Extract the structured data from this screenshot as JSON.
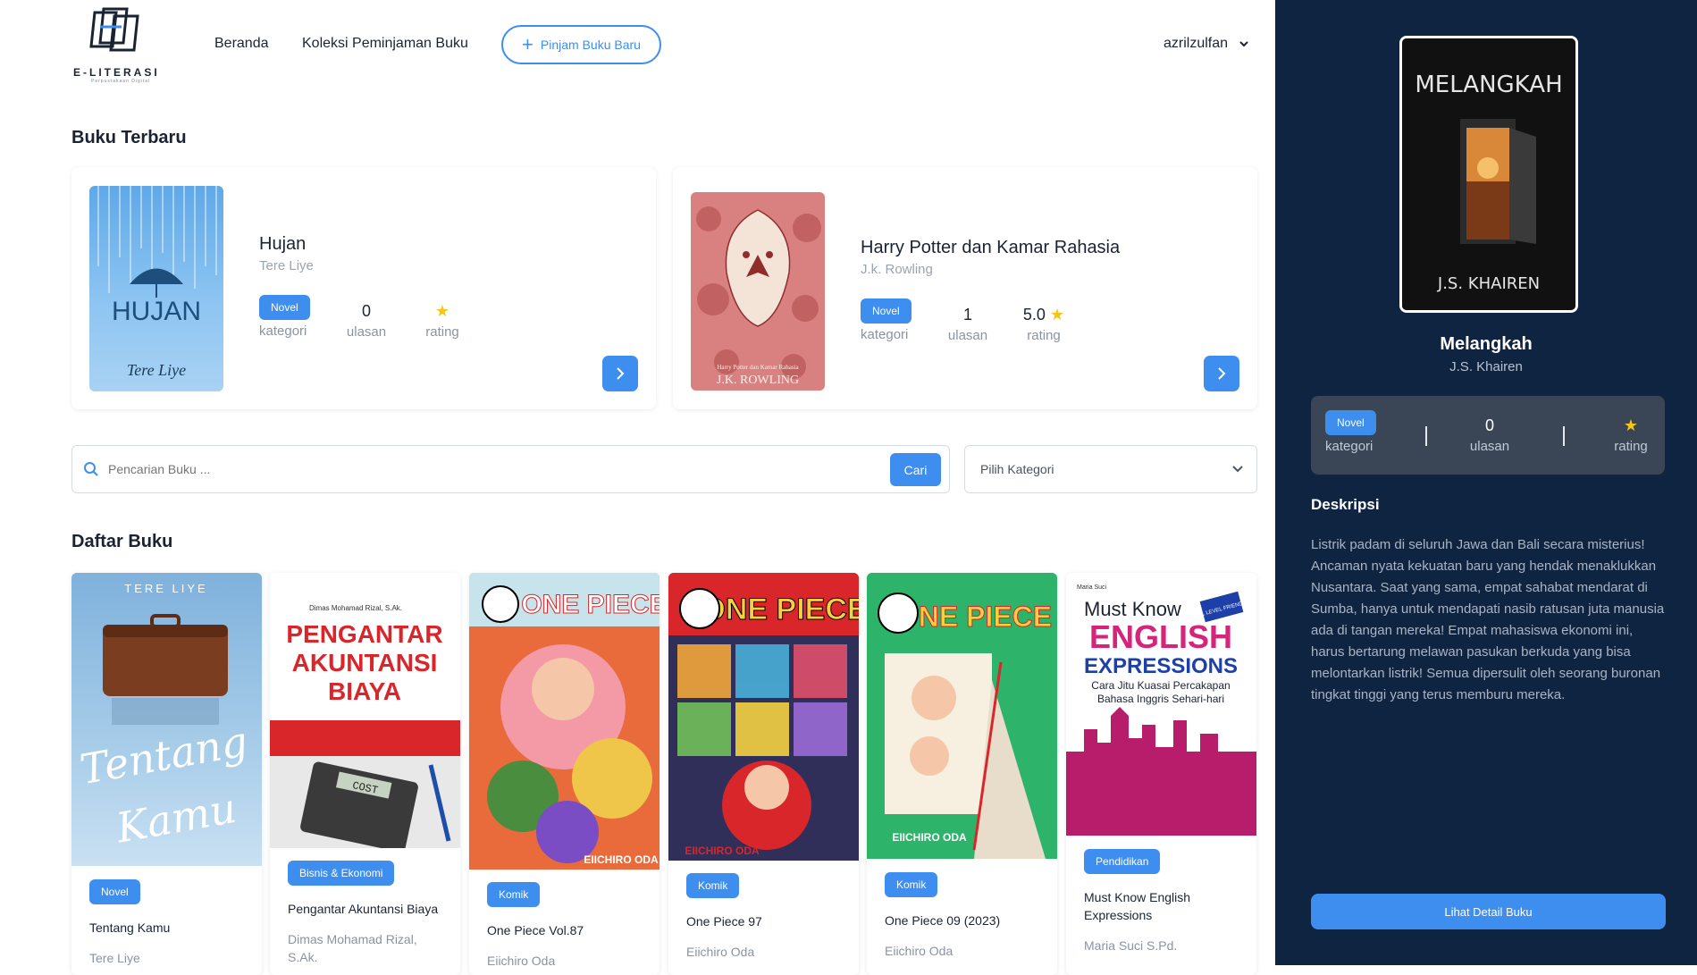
{
  "header": {
    "logo_text": "E-LITERASI",
    "logo_subtext": "Perpustakaan Digital",
    "nav": [
      "Beranda",
      "Koleksi Peminjaman Buku"
    ],
    "cta_label": "Pinjam Buku Baru",
    "username": "azrilzulfan"
  },
  "latest": {
    "title": "Buku Terbaru",
    "books": [
      {
        "title": "Hujan",
        "author": "Tere Liye",
        "category": "Novel",
        "category_label": "kategori",
        "reviews": "0",
        "reviews_label": "ulasan",
        "rating": "",
        "rating_label": "rating"
      },
      {
        "title": "Harry Potter dan Kamar Rahasia",
        "author": "J.k. Rowling",
        "category": "Novel",
        "category_label": "kategori",
        "reviews": "1",
        "reviews_label": "ulasan",
        "rating": "5.0",
        "rating_label": "rating"
      }
    ]
  },
  "search": {
    "placeholder": "Pencarian Buku ...",
    "button": "Cari",
    "category_select": "Pilih Kategori"
  },
  "list": {
    "title": "Daftar Buku",
    "books": [
      {
        "title": "Tentang Kamu",
        "author": "Tere Liye",
        "category": "Novel"
      },
      {
        "title": "Pengantar Akuntansi Biaya",
        "author": "Dimas Mohamad Rizal, S.Ak.",
        "category": "Bisnis & Ekonomi"
      },
      {
        "title": "One Piece Vol.87",
        "author": "Eiichiro Oda",
        "category": "Komik"
      },
      {
        "title": "One Piece 97",
        "author": "Eiichiro Oda",
        "category": "Komik"
      },
      {
        "title": "One Piece 09 (2023)",
        "author": "Eiichiro Oda",
        "category": "Komik"
      },
      {
        "title": "Must Know English Expressions",
        "author": "Maria Suci S.Pd.",
        "category": "Pendidikan"
      }
    ]
  },
  "covers": {
    "hujan": {
      "title": "HUJAN",
      "author": "Tere Liye"
    },
    "hp": {
      "author": "J.K. ROWLING",
      "subtitle": "Harry Potter dan Kamar Rahasia"
    },
    "tentang": {
      "author": "TERE LIYE",
      "title1": "Tentang",
      "title2": "Kamu"
    },
    "akuntansi": {
      "author": "Dimas Mohamad Rizal, S.Ak.",
      "title1": "PENGANTAR",
      "title2": "AKUNTANSI",
      "title3": "BIAYA",
      "sign": "COST"
    },
    "op": {
      "title": "ONE PIECE",
      "author": "EIICHIRO ODA"
    },
    "english": {
      "author": "Maria Suci",
      "line1": "Must Know",
      "line2": "ENGLISH",
      "line3": "EXPRESSIONS",
      "line4": "Cara Jitu Kuasai Percakapan",
      "line5": "Bahasa Inggris Sehari-hari",
      "tag": "ALL LEVEL FRIENDLY"
    },
    "melangkah": {
      "title": "MELANGKAH",
      "author": "J.S. KHAIREN"
    }
  },
  "detail": {
    "title": "Melangkah",
    "author": "J.S. Khairen",
    "category": "Novel",
    "category_label": "kategori",
    "reviews": "0",
    "reviews_label": "ulasan",
    "rating_label": "rating",
    "desc_title": "Deskripsi",
    "description": "Listrik padam di seluruh Jawa dan Bali secara misterius! Ancaman nyata kekuatan baru yang hendak menaklukkan Nusantara. Saat yang sama, empat sahabat mendarat di Sumba, hanya untuk mendapati nasib ratusan juta manusia ada di tangan mereka! Empat mahasiswa ekonomi ini, harus bertarung melawan pasukan berkuda yang bisa melontarkan listrik! Semua dipersulit oleh seorang buronan tingkat tinggi yang terus memburu mereka.",
    "button": "Lihat Detail Buku"
  },
  "colors": {
    "accent": "#3e8ef0",
    "sidebar": "#0f2440",
    "star": "#f5c518"
  }
}
